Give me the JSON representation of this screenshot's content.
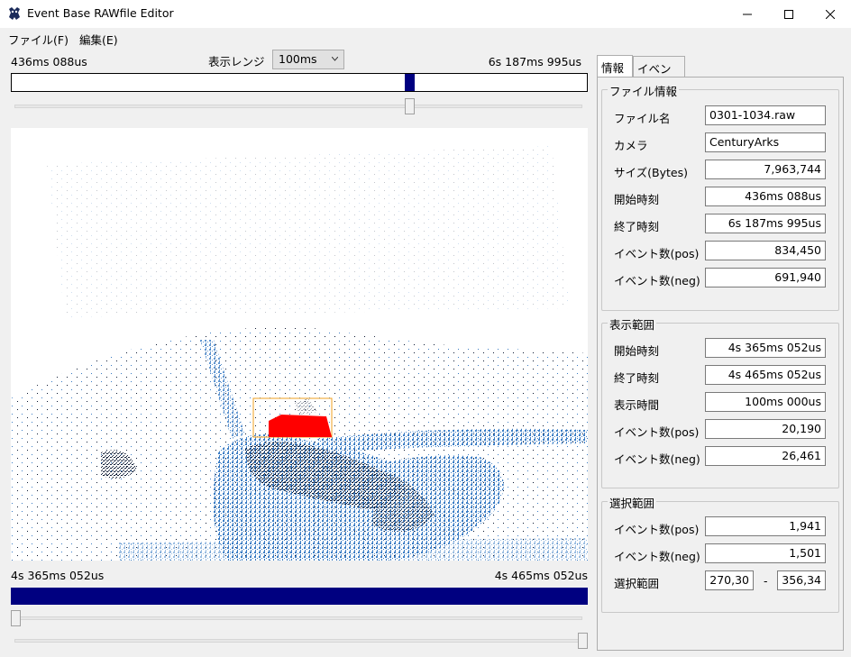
{
  "window": {
    "title": "Event Base RAWfile Editor"
  },
  "menu": [
    {
      "label": "ファイル(F)"
    },
    {
      "label": "編集(E)"
    }
  ],
  "toolbar": {
    "range_start": "436ms 088us",
    "range_label": "表示レンジ",
    "range_value": "100ms",
    "range_end": "6s 187ms 995us"
  },
  "selection": {
    "start": "4s 365ms 052us",
    "end": "4s 465ms 052us"
  },
  "tabs": [
    {
      "label": "情報"
    },
    {
      "label": "イベント"
    }
  ],
  "file_info": {
    "title": "ファイル情報",
    "rows": [
      {
        "label": "ファイル名",
        "value": "0301-1034.raw"
      },
      {
        "label": "カメラ",
        "value": "CenturyArks"
      },
      {
        "label": "サイズ(Bytes)",
        "value": "7,963,744"
      },
      {
        "label": "開始時刻",
        "value": "436ms 088us"
      },
      {
        "label": "終了時刻",
        "value": "6s 187ms 995us"
      },
      {
        "label": "イベント数(pos)",
        "value": "834,450"
      },
      {
        "label": "イベント数(neg)",
        "value": "691,940"
      }
    ]
  },
  "display_range": {
    "title": "表示範囲",
    "rows": [
      {
        "label": "開始時刻",
        "value": "4s 365ms 052us"
      },
      {
        "label": "終了時刻",
        "value": "4s 465ms 052us"
      },
      {
        "label": "表示時間",
        "value": "100ms 000us"
      },
      {
        "label": "イベント数(pos)",
        "value": "20,190"
      },
      {
        "label": "イベント数(neg)",
        "value": "26,461"
      }
    ]
  },
  "selected_range": {
    "title": "選択範囲",
    "rows": [
      {
        "label": "イベント数(pos)",
        "value": "1,941"
      },
      {
        "label": "イベント数(neg)",
        "value": "1,501"
      }
    ],
    "range_label": "選択範囲",
    "range_from": "270,30",
    "range_sep": "-",
    "range_to": "356,34"
  },
  "colors": {
    "timeline": "#000080",
    "pos_events": "#3a7cc4",
    "neg_events": "#0d1a33",
    "selection_box": "#f0a020",
    "selected_events": "#ff0000"
  }
}
